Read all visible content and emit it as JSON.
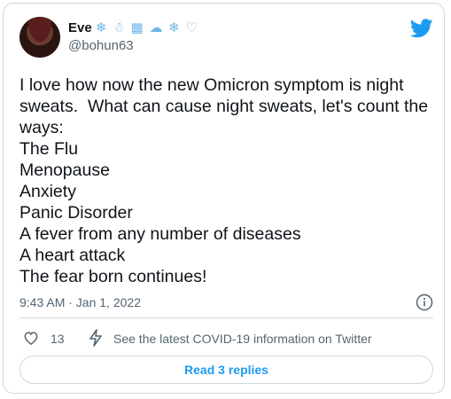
{
  "author": {
    "display_name": "Eve",
    "name_emojis": "❄ ☃ ▦ ☁ ❄ ♡",
    "handle": "@bohun63"
  },
  "tweet": {
    "text": "I love how now the new Omicron symptom is night sweats.  What can cause night sweats, let's count the ways:\nThe Flu\nMenopause\nAnxiety\nPanic Disorder\nA fever from any number of diseases\nA heart attack\nThe fear born continues!",
    "timestamp": "9:43 AM · Jan 1, 2022"
  },
  "actions": {
    "like_count": "13",
    "covid_info": "See the latest COVID-19 information on Twitter",
    "replies_button": "Read 3 replies"
  },
  "icons": {
    "logo": "twitter-bird-icon",
    "info": "info-icon",
    "like": "heart-icon",
    "covid": "lightning-bolt-icon"
  },
  "colors": {
    "brand": "#1d9bf0",
    "text": "#0f1419",
    "secondary": "#536471",
    "border": "#cfd9de"
  }
}
